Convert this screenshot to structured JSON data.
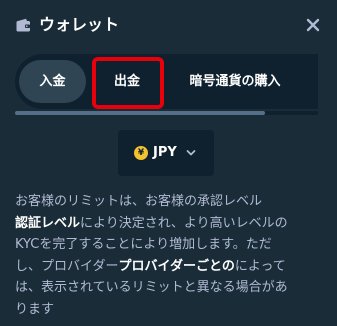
{
  "header": {
    "title": "ウォレット",
    "wallet_icon": "wallet-icon",
    "close_icon": "close-icon"
  },
  "tabs": [
    {
      "label": "入金",
      "active": true
    },
    {
      "label": "出金",
      "active": false,
      "highlighted": true
    },
    {
      "label": "暗号通貨の購入",
      "active": false
    }
  ],
  "currency": {
    "code": "JPY",
    "coin_symbol": "¥",
    "icon": "yen-coin-icon",
    "dropdown_icon": "chevron-down-icon"
  },
  "info": {
    "line1": "お客様のリミットは、お客様の承認レベル",
    "line2_bold": "認証レベル",
    "line2": "により決定され、より高いレベルの",
    "line3": "KYCを完了することにより増加します。ただ",
    "line4_pre": "し、プロバイダー",
    "line4_bold": "プロバイダーごとの",
    "line4_post": "によって",
    "line5": "は、表示されているリミットと異なる場合があ",
    "line6": "ります"
  },
  "colors": {
    "background": "#1a2c38",
    "panel": "#0f212e",
    "active_tab": "#2f4553",
    "highlight": "#e8000b",
    "coin": "#f2c230",
    "muted_text": "#b1bad3"
  }
}
